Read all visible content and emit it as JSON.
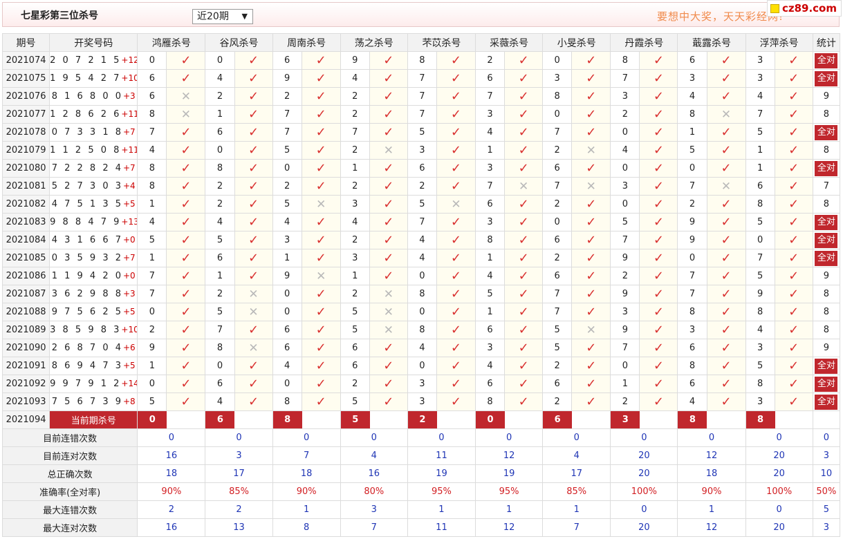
{
  "header": {
    "title": "七星彩第三位杀号",
    "period_select": "近20期",
    "slogan": "要想中大奖，天天彩经网!",
    "watermark": "cz89.com"
  },
  "table": {
    "columns": {
      "period": "期号",
      "draw": "开奖号码",
      "experts": [
        "鸿雁杀号",
        "谷风杀号",
        "周南杀号",
        "荡之杀号",
        "芣苡杀号",
        "采薇杀号",
        "小旻杀号",
        "丹霞杀号",
        "蕺露杀号",
        "浮萍杀号"
      ],
      "stat": "统计"
    },
    "all_correct_label": "全对",
    "rows": [
      {
        "period": "2021074",
        "digits": "2 0 7 2 1 5",
        "sum": "+12",
        "kills": [
          0,
          0,
          6,
          9,
          8,
          2,
          0,
          8,
          6,
          3
        ],
        "ok": [
          1,
          1,
          1,
          1,
          1,
          1,
          1,
          1,
          1,
          1
        ],
        "stat": "全对"
      },
      {
        "period": "2021075",
        "digits": "1 9 5 4 2 7",
        "sum": "+10",
        "kills": [
          6,
          4,
          9,
          4,
          7,
          6,
          3,
          7,
          3,
          3
        ],
        "ok": [
          1,
          1,
          1,
          1,
          1,
          1,
          1,
          1,
          1,
          1
        ],
        "stat": "全对"
      },
      {
        "period": "2021076",
        "digits": "8 1 6 8 0 0",
        "sum": "+3",
        "kills": [
          6,
          2,
          2,
          2,
          7,
          7,
          8,
          3,
          4,
          4
        ],
        "ok": [
          0,
          1,
          1,
          1,
          1,
          1,
          1,
          1,
          1,
          1
        ],
        "stat": "9"
      },
      {
        "period": "2021077",
        "digits": "1 2 8 6 2 6",
        "sum": "+11",
        "kills": [
          8,
          1,
          7,
          2,
          7,
          3,
          0,
          2,
          8,
          7
        ],
        "ok": [
          0,
          1,
          1,
          1,
          1,
          1,
          1,
          1,
          0,
          1
        ],
        "stat": "8"
      },
      {
        "period": "2021078",
        "digits": "0 7 3 3 1 8",
        "sum": "+7",
        "kills": [
          7,
          6,
          7,
          7,
          5,
          4,
          7,
          0,
          1,
          5
        ],
        "ok": [
          1,
          1,
          1,
          1,
          1,
          1,
          1,
          1,
          1,
          1
        ],
        "stat": "全对"
      },
      {
        "period": "2021079",
        "digits": "1 1 2 5 0 8",
        "sum": "+11",
        "kills": [
          4,
          0,
          5,
          2,
          3,
          1,
          2,
          4,
          5,
          1
        ],
        "ok": [
          1,
          1,
          1,
          0,
          1,
          1,
          0,
          1,
          1,
          1
        ],
        "stat": "8"
      },
      {
        "period": "2021080",
        "digits": "7 2 2 8 2 4",
        "sum": "+7",
        "kills": [
          8,
          8,
          0,
          1,
          6,
          3,
          6,
          0,
          0,
          1
        ],
        "ok": [
          1,
          1,
          1,
          1,
          1,
          1,
          1,
          1,
          1,
          1
        ],
        "stat": "全对"
      },
      {
        "period": "2021081",
        "digits": "5 2 7 3 0 3",
        "sum": "+4",
        "kills": [
          8,
          2,
          2,
          2,
          2,
          7,
          7,
          3,
          7,
          6
        ],
        "ok": [
          1,
          1,
          1,
          1,
          1,
          0,
          0,
          1,
          0,
          1
        ],
        "stat": "7"
      },
      {
        "period": "2021082",
        "digits": "4 7 5 1 3 5",
        "sum": "+5",
        "kills": [
          1,
          2,
          5,
          3,
          5,
          6,
          2,
          0,
          2,
          8
        ],
        "ok": [
          1,
          1,
          0,
          1,
          0,
          1,
          1,
          1,
          1,
          1
        ],
        "stat": "8"
      },
      {
        "period": "2021083",
        "digits": "9 8 8 4 7 9",
        "sum": "+13",
        "kills": [
          4,
          4,
          4,
          4,
          7,
          3,
          0,
          5,
          9,
          5
        ],
        "ok": [
          1,
          1,
          1,
          1,
          1,
          1,
          1,
          1,
          1,
          1
        ],
        "stat": "全对"
      },
      {
        "period": "2021084",
        "digits": "4 3 1 6 6 7",
        "sum": "+0",
        "kills": [
          5,
          5,
          3,
          2,
          4,
          8,
          6,
          7,
          9,
          0
        ],
        "ok": [
          1,
          1,
          1,
          1,
          1,
          1,
          1,
          1,
          1,
          1
        ],
        "stat": "全对"
      },
      {
        "period": "2021085",
        "digits": "0 3 5 9 3 2",
        "sum": "+7",
        "kills": [
          1,
          6,
          1,
          3,
          4,
          1,
          2,
          9,
          0,
          7
        ],
        "ok": [
          1,
          1,
          1,
          1,
          1,
          1,
          1,
          1,
          1,
          1
        ],
        "stat": "全对"
      },
      {
        "period": "2021086",
        "digits": "1 1 9 4 2 0",
        "sum": "+0",
        "kills": [
          7,
          1,
          9,
          1,
          0,
          4,
          6,
          2,
          7,
          5
        ],
        "ok": [
          1,
          1,
          0,
          1,
          1,
          1,
          1,
          1,
          1,
          1
        ],
        "stat": "9"
      },
      {
        "period": "2021087",
        "digits": "3 6 2 9 8 8",
        "sum": "+3",
        "kills": [
          7,
          2,
          0,
          2,
          8,
          5,
          7,
          9,
          7,
          9
        ],
        "ok": [
          1,
          0,
          1,
          0,
          1,
          1,
          1,
          1,
          1,
          1
        ],
        "stat": "8"
      },
      {
        "period": "2021088",
        "digits": "9 7 5 6 2 5",
        "sum": "+5",
        "kills": [
          0,
          5,
          0,
          5,
          0,
          1,
          7,
          3,
          8,
          8
        ],
        "ok": [
          1,
          0,
          1,
          0,
          1,
          1,
          1,
          1,
          1,
          1
        ],
        "stat": "8"
      },
      {
        "period": "2021089",
        "digits": "3 8 5 9 8 3",
        "sum": "+10",
        "kills": [
          2,
          7,
          6,
          5,
          8,
          6,
          5,
          9,
          3,
          4
        ],
        "ok": [
          1,
          1,
          1,
          0,
          1,
          1,
          0,
          1,
          1,
          1
        ],
        "stat": "8"
      },
      {
        "period": "2021090",
        "digits": "2 6 8 7 0 4",
        "sum": "+6",
        "kills": [
          9,
          8,
          6,
          6,
          4,
          3,
          5,
          7,
          6,
          3
        ],
        "ok": [
          1,
          0,
          1,
          1,
          1,
          1,
          1,
          1,
          1,
          1
        ],
        "stat": "9"
      },
      {
        "period": "2021091",
        "digits": "8 6 9 4 7 3",
        "sum": "+5",
        "kills": [
          1,
          0,
          4,
          6,
          0,
          4,
          2,
          0,
          8,
          5
        ],
        "ok": [
          1,
          1,
          1,
          1,
          1,
          1,
          1,
          1,
          1,
          1
        ],
        "stat": "全对"
      },
      {
        "period": "2021092",
        "digits": "9 9 7 9 1 2",
        "sum": "+14",
        "kills": [
          0,
          6,
          0,
          2,
          3,
          6,
          6,
          1,
          6,
          8
        ],
        "ok": [
          1,
          1,
          1,
          1,
          1,
          1,
          1,
          1,
          1,
          1
        ],
        "stat": "全对"
      },
      {
        "period": "2021093",
        "digits": "7 5 6 7 3 9",
        "sum": "+8",
        "kills": [
          5,
          4,
          8,
          5,
          3,
          8,
          2,
          2,
          4,
          3
        ],
        "ok": [
          1,
          1,
          1,
          1,
          1,
          1,
          1,
          1,
          1,
          1
        ],
        "stat": "全对"
      }
    ],
    "current": {
      "period": "2021094",
      "label": "当前期杀号",
      "kills": [
        0,
        6,
        8,
        5,
        2,
        0,
        6,
        3,
        8,
        8
      ]
    },
    "stats": [
      {
        "label": "目前连错次数",
        "values": [
          "0",
          "0",
          "0",
          "0",
          "0",
          "0",
          "0",
          "0",
          "0",
          "0"
        ],
        "total": "0"
      },
      {
        "label": "目前连对次数",
        "values": [
          "16",
          "3",
          "7",
          "4",
          "11",
          "12",
          "4",
          "20",
          "12",
          "20"
        ],
        "total": "3"
      },
      {
        "label": "总正确次数",
        "values": [
          "18",
          "17",
          "18",
          "16",
          "19",
          "19",
          "17",
          "20",
          "18",
          "20"
        ],
        "total": "10"
      },
      {
        "label": "准确率(全对率)",
        "values": [
          "90%",
          "85%",
          "90%",
          "80%",
          "95%",
          "95%",
          "85%",
          "100%",
          "90%",
          "100%"
        ],
        "total": "50%"
      },
      {
        "label": "最大连错次数",
        "values": [
          "2",
          "2",
          "1",
          "3",
          "1",
          "1",
          "1",
          "0",
          "1",
          "0"
        ],
        "total": "5"
      },
      {
        "label": "最大连对次数",
        "values": [
          "16",
          "13",
          "8",
          "7",
          "11",
          "12",
          "7",
          "20",
          "12",
          "20"
        ],
        "total": "3"
      }
    ]
  }
}
